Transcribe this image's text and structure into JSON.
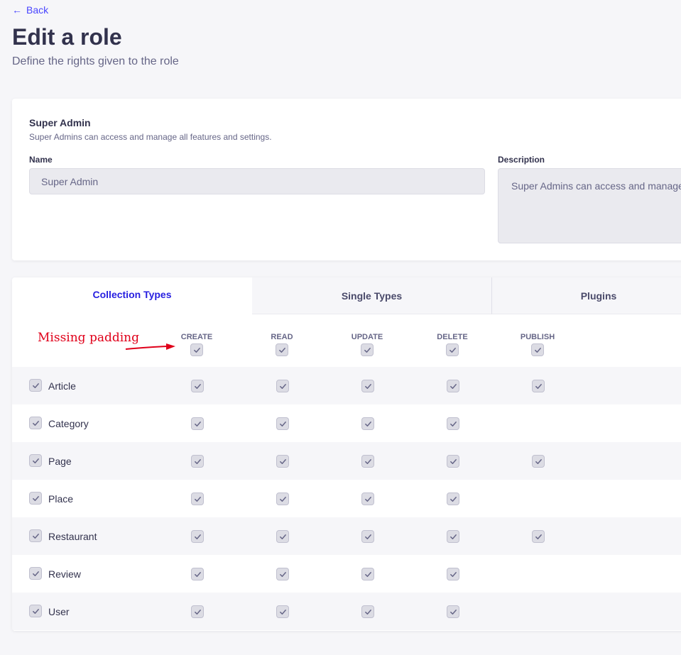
{
  "nav": {
    "back_label": "Back"
  },
  "header": {
    "title": "Edit a role",
    "subtitle": "Define the rights given to the role"
  },
  "role": {
    "name": "Super Admin",
    "description": "Super Admins can access and manage all features and settings.",
    "name_label": "Name",
    "name_value": "Super Admin",
    "description_label": "Description",
    "description_value": "Super Admins can access and manage all features and settings."
  },
  "tabs": [
    {
      "label": "Collection Types",
      "active": true
    },
    {
      "label": "Single Types",
      "active": false
    },
    {
      "label": "Plugins",
      "active": false
    }
  ],
  "columns": [
    "CREATE",
    "READ",
    "UPDATE",
    "DELETE",
    "PUBLISH"
  ],
  "rows": [
    {
      "label": "Article",
      "perms": [
        true,
        true,
        true,
        true,
        true
      ]
    },
    {
      "label": "Category",
      "perms": [
        true,
        true,
        true,
        true,
        false
      ]
    },
    {
      "label": "Page",
      "perms": [
        true,
        true,
        true,
        true,
        true
      ]
    },
    {
      "label": "Place",
      "perms": [
        true,
        true,
        true,
        true,
        false
      ]
    },
    {
      "label": "Restaurant",
      "perms": [
        true,
        true,
        true,
        true,
        true
      ]
    },
    {
      "label": "Review",
      "perms": [
        true,
        true,
        true,
        true,
        false
      ]
    },
    {
      "label": "User",
      "perms": [
        true,
        true,
        true,
        true,
        false
      ]
    }
  ],
  "annotation": {
    "text": "Missing padding",
    "color": "#e0001a"
  },
  "colors": {
    "accent": "#4945ff",
    "active_tab": "#271fe0",
    "text": "#32324d",
    "muted": "#666687"
  }
}
